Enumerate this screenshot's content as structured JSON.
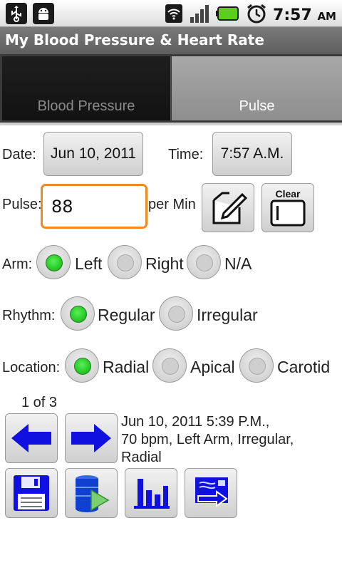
{
  "status_bar": {
    "time": "7:57",
    "ampm": "AM",
    "icons": [
      "usb-icon",
      "android-debug-icon",
      "wifi-icon",
      "signal-icon",
      "battery-icon",
      "alarm-icon"
    ]
  },
  "app": {
    "title": "My Blood Pressure & Heart Rate"
  },
  "tabs": [
    {
      "label": "Blood Pressure",
      "selected": false
    },
    {
      "label": "Pulse",
      "selected": true
    }
  ],
  "form": {
    "date_label": "Date:",
    "date_value": "Jun 10, 2011",
    "time_label": "Time:",
    "time_value": "7:57 A.M.",
    "pulse_label": "Pulse:",
    "pulse_value": "88",
    "pulse_unit": "per Min",
    "clear_label": "Clear",
    "arm": {
      "label": "Arm:",
      "options": [
        {
          "label": "Left",
          "checked": true
        },
        {
          "label": "Right",
          "checked": false
        },
        {
          "label": "N/A",
          "checked": false
        }
      ]
    },
    "rhythm": {
      "label": "Rhythm:",
      "options": [
        {
          "label": "Regular",
          "checked": true
        },
        {
          "label": "Irregular",
          "checked": false
        }
      ]
    },
    "location": {
      "label": "Location:",
      "options": [
        {
          "label": "Radial",
          "checked": true
        },
        {
          "label": "Apical",
          "checked": false
        },
        {
          "label": "Carotid",
          "checked": false
        }
      ]
    }
  },
  "history": {
    "counter": "1 of 3",
    "entry_line1": "Jun 10, 2011 5:39 P.M.,",
    "entry_line2": "70 bpm, Left Arm, Irregular,",
    "entry_line3": "Radial"
  },
  "colors": {
    "accent_orange": "#f08a1e",
    "radio_green": "#08b008",
    "icon_blue": "#1010e0"
  }
}
